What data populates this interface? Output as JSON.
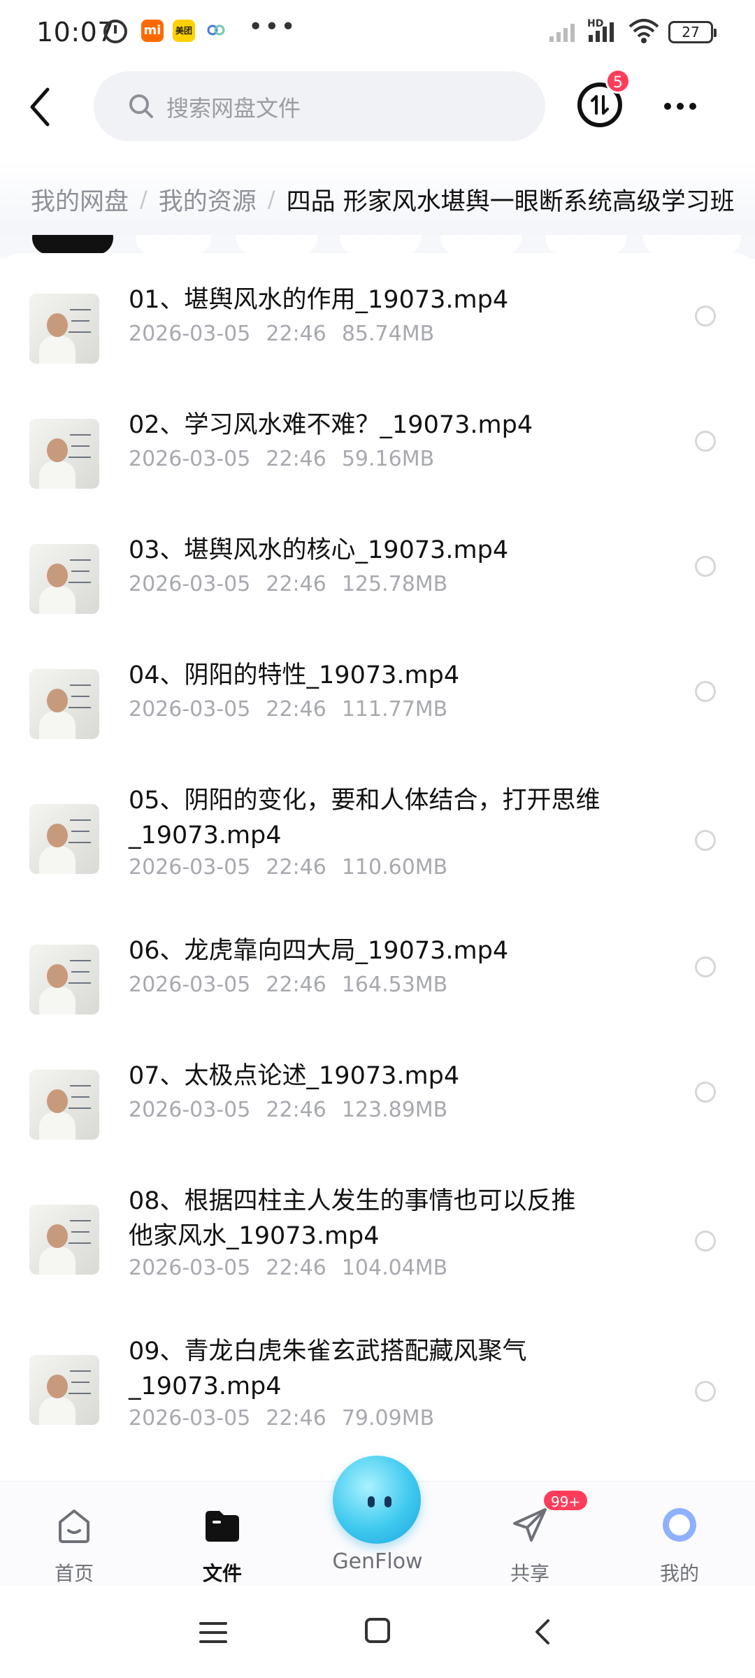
{
  "status_bar": {
    "time": "10:07",
    "mi_label": "mi",
    "meituan_label": "美团",
    "network": "HD",
    "battery": "27"
  },
  "header": {
    "search_placeholder": "搜索网盘文件",
    "transfer_badge": "5"
  },
  "breadcrumb": {
    "items": [
      "我的网盘",
      "我的资源"
    ],
    "current": "四品 形家风水堪舆一眼断系统高级学习班"
  },
  "files": [
    {
      "name": "01、堪舆风水的作用_19073.mp4",
      "date": "2026-03-05",
      "time": "22:46",
      "size": "85.74MB"
    },
    {
      "name": "02、学习风水难不难？_19073.mp4",
      "date": "2026-03-05",
      "time": "22:46",
      "size": "59.16MB"
    },
    {
      "name": "03、堪舆风水的核心_19073.mp4",
      "date": "2026-03-05",
      "time": "22:46",
      "size": "125.78MB"
    },
    {
      "name": "04、阴阳的特性_19073.mp4",
      "date": "2026-03-05",
      "time": "22:46",
      "size": "111.77MB"
    },
    {
      "name": "05、阴阳的变化，要和人体结合，打开思维_19073.mp4",
      "date": "2026-03-05",
      "time": "22:46",
      "size": "110.60MB"
    },
    {
      "name": "06、龙虎靠向四大局_19073.mp4",
      "date": "2026-03-05",
      "time": "22:46",
      "size": "164.53MB"
    },
    {
      "name": "07、太极点论述_19073.mp4",
      "date": "2026-03-05",
      "time": "22:46",
      "size": "123.89MB"
    },
    {
      "name": "08、根据四柱主人发生的事情也可以反推他家风水_19073.mp4",
      "date": "2026-03-05",
      "time": "22:46",
      "size": "104.04MB"
    },
    {
      "name": "09、青龙白虎朱雀玄武搭配藏风聚气_19073.mp4",
      "date": "2026-03-05",
      "time": "22:46",
      "size": "79.09MB"
    }
  ],
  "bottom_nav": {
    "home": "首页",
    "files": "文件",
    "genflow": "GenFlow",
    "share": "共享",
    "share_badge": "99+",
    "me": "我的"
  },
  "icons": {
    "back": "chevron-left-icon",
    "search": "search-icon",
    "transfer": "transfer-icon",
    "more": "more-icon"
  },
  "colors": {
    "badge": "#ff3d5a",
    "accent": "#111111",
    "meta_text": "#a7a9af",
    "genflow": "#3fc9ef"
  }
}
